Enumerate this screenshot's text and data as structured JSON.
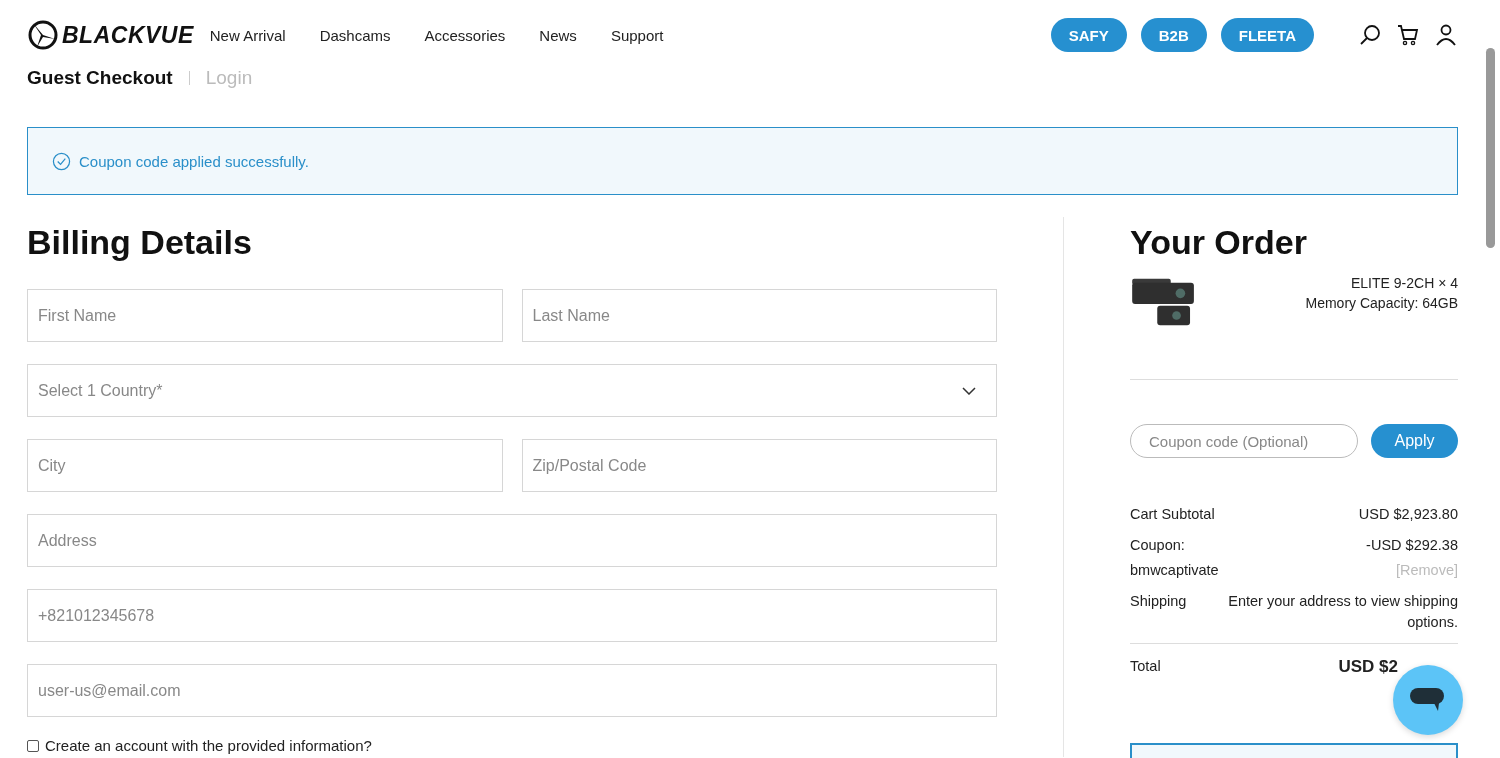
{
  "header": {
    "logo": "BLACKVUE",
    "nav": [
      "New Arrival",
      "Dashcams",
      "Accessories",
      "News",
      "Support"
    ],
    "pills": [
      "SAFY",
      "B2B",
      "FLEETA"
    ]
  },
  "checkout_tabs": [
    {
      "label": "Guest Checkout",
      "selected": true
    },
    {
      "label": "Login",
      "selected": false
    }
  ],
  "alert": {
    "message": "Coupon code applied successfully."
  },
  "billing": {
    "title": "Billing Details",
    "rows": [
      [
        {
          "kind": "text",
          "placeholder": "First Name"
        },
        {
          "kind": "text",
          "placeholder": "Last Name"
        }
      ],
      [
        {
          "kind": "select",
          "placeholder": "Select 1 Country*"
        }
      ],
      [
        {
          "kind": "text",
          "placeholder": "City"
        },
        {
          "kind": "text",
          "placeholder": "Zip/Postal Code"
        }
      ],
      [
        {
          "kind": "text",
          "placeholder": "Address"
        }
      ],
      [
        {
          "kind": "text",
          "placeholder": "+821012345678"
        }
      ],
      [
        {
          "kind": "text",
          "placeholder": "user-us@email.com"
        }
      ]
    ],
    "create_account": {
      "label": "Create an account with the provided information?",
      "checked": false
    }
  },
  "order": {
    "title": "Your Order",
    "item": {
      "name": "ELITE 9-2CH × 4",
      "option": "Memory Capacity: 64GB"
    },
    "coupon": {
      "placeholder": "Coupon code (Optional)",
      "button": "Apply"
    },
    "subtotal": {
      "label": "Cart Subtotal",
      "value": "USD $2,923.80"
    },
    "discount": {
      "label": "Coupon:",
      "code": "bmwcaptivate",
      "value": "-USD $292.38",
      "remove": "[Remove]"
    },
    "shipping": {
      "label": "Shipping",
      "value": "Enter your address to view shipping options."
    },
    "total": {
      "label": "Total",
      "value": "USD $2"
    }
  }
}
